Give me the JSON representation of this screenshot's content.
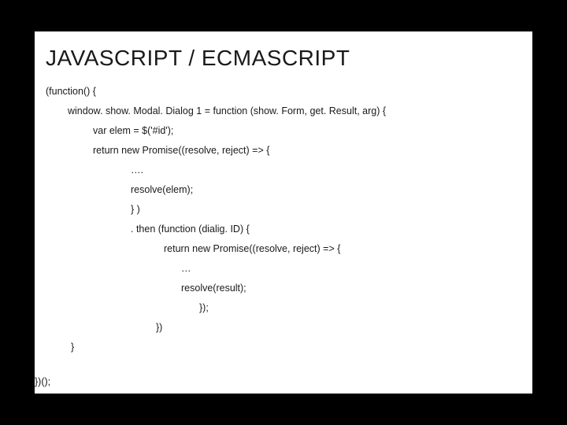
{
  "slide": {
    "title": "JAVASCRIPT / ECMASCRIPT",
    "code": {
      "l1": "(function() {",
      "l2": "window. show. Modal. Dialog 1 = function (show. Form, get. Result, arg) {",
      "l3": "var elem = $('#id');",
      "l4": "return new Promise((resolve, reject) => {",
      "l5": "…. ",
      "l6": "resolve(elem);",
      "l7": "} )",
      "l8": ". then (function (dialig. ID) {",
      "l9": "return new Promise((resolve, reject) => {",
      "l10": "…",
      "l11": "resolve(result);",
      "l12": "});",
      "l13": "})",
      "l14": "}",
      "l15": "})();"
    }
  }
}
